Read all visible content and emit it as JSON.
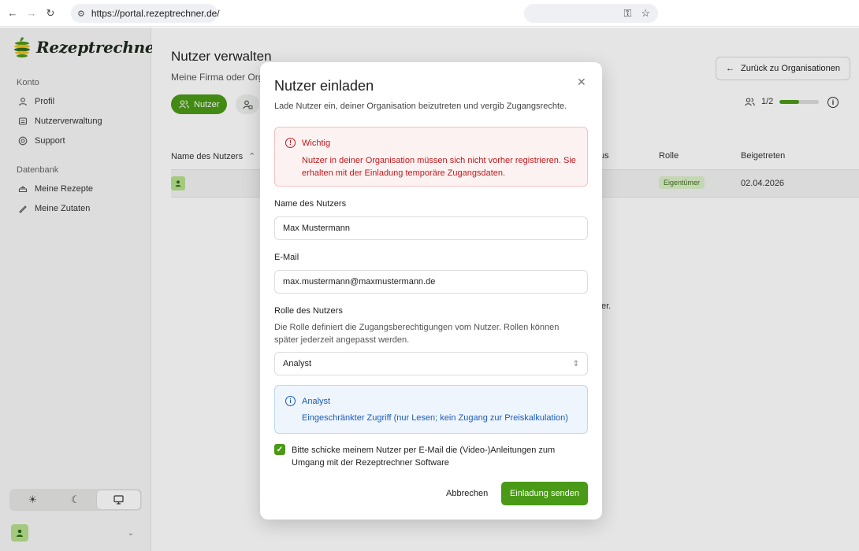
{
  "browser": {
    "url": "https://portal.rezeptrechner.de/"
  },
  "sidebar": {
    "logo_text": "Rezeptrechner",
    "section_account": "Konto",
    "items_account": [
      {
        "label": "Profil",
        "icon": "user-icon"
      },
      {
        "label": "Nutzerverwaltung",
        "icon": "users-admin-icon"
      },
      {
        "label": "Support",
        "icon": "support-icon"
      }
    ],
    "section_db": "Datenbank",
    "items_db": [
      {
        "label": "Meine Rezepte",
        "icon": "recipe-icon"
      },
      {
        "label": "Meine Zutaten",
        "icon": "ingredient-icon"
      }
    ],
    "theme_options": [
      "light",
      "dark",
      "system"
    ],
    "theme_selected": "system"
  },
  "main": {
    "title": "Nutzer verwalten",
    "subtitle": "Meine Firma oder Org",
    "tab_users": "Nutzer",
    "back_button": "Zurück zu Organisationen",
    "quota_text": "1/2",
    "quota_fraction": 0.5,
    "columns": {
      "name": "Name des Nutzers",
      "status": "us",
      "role": "Rolle",
      "joined": "Beigetreten"
    },
    "row": {
      "role": "Eigentümer",
      "joined": "02.04.2026"
    },
    "bg_fragment": "er."
  },
  "modal": {
    "title": "Nutzer einladen",
    "lead": "Lade Nutzer ein, deiner Organisation beizutreten und vergib Zugangsrechte.",
    "alert_title": "Wichtig",
    "alert_body": "Nutzer in deiner Organisation müssen sich nicht vorher registrieren. Sie erhalten mit der Einladung temporäre Zugangsdaten.",
    "name_label": "Name des Nutzers",
    "name_value": "Max Mustermann",
    "email_label": "E-Mail",
    "email_value": "max.mustermann@maxmustermann.de",
    "role_label": "Rolle des Nutzers",
    "role_hint": "Die Rolle definiert die Zugangsberechtigungen vom Nutzer. Rollen können später jederzeit angepasst werden.",
    "role_value": "Analyst",
    "info_title": "Analyst",
    "info_body": "Eingeschränkter Zugriff (nur Lesen; kein Zugang zur Preiskalkulation)",
    "checkbox_label": "Bitte schicke meinem Nutzer per E-Mail die (Video-)Anleitungen zum Umgang mit der Rezeptrechner Software",
    "checkbox_checked": true,
    "cancel": "Abbrechen",
    "submit": "Einladung senden"
  },
  "colors": {
    "accent": "#4a9a17",
    "danger": "#c0181c",
    "info": "#1e5bb8"
  }
}
